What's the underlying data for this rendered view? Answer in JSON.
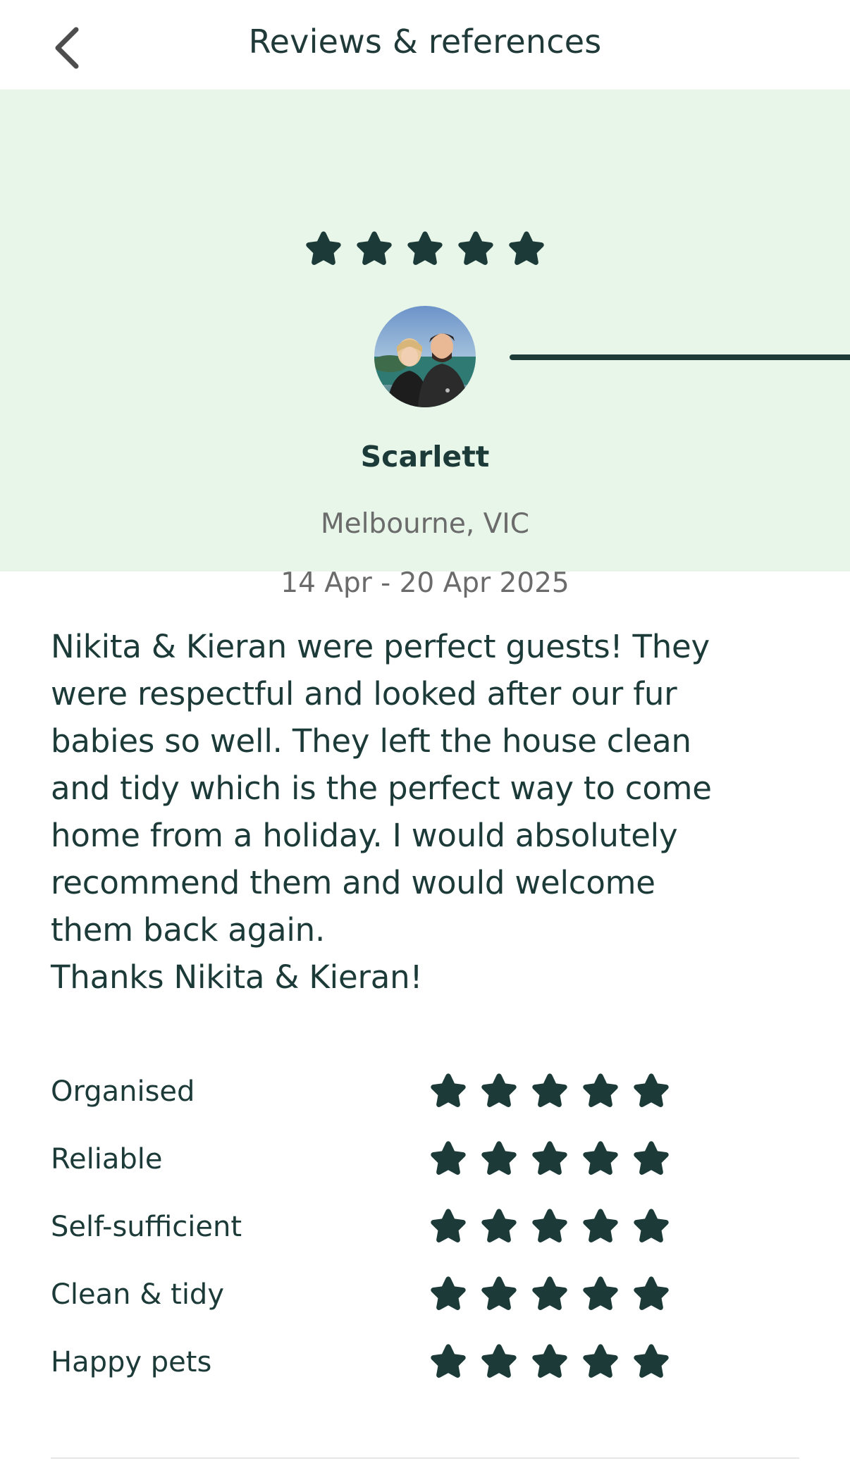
{
  "header": {
    "title": "Reviews & references",
    "back_icon": "chevron-left-icon"
  },
  "review": {
    "overall_rating": 5,
    "overall_rating_max": 5,
    "reviewer_name": "Scarlett",
    "location": "Melbourne, VIC",
    "dates": "14 Apr - 20 Apr 2025",
    "avatar": "avatar-photo",
    "text": "Nikita & Kieran were perfect guests! They\nwere respectful and looked after our fur\nbabies so well. They left the house clean\nand tidy which is the perfect way to come\nhome from a holiday. I would absolutely\nrecommend them and would welcome\nthem back again.\nThanks Nikita & Kieran!"
  },
  "ratings": [
    {
      "label": "Organised",
      "value": 5,
      "max": 5
    },
    {
      "label": "Reliable",
      "value": 5,
      "max": 5
    },
    {
      "label": "Self-sufficient",
      "value": 5,
      "max": 5
    },
    {
      "label": "Clean & tidy",
      "value": 5,
      "max": 5
    },
    {
      "label": "Happy pets",
      "value": 5,
      "max": 5
    }
  ],
  "colors": {
    "accent": "#1b3a38",
    "hero_background": "#e8f6e9",
    "muted_text": "#6b6b6b"
  }
}
